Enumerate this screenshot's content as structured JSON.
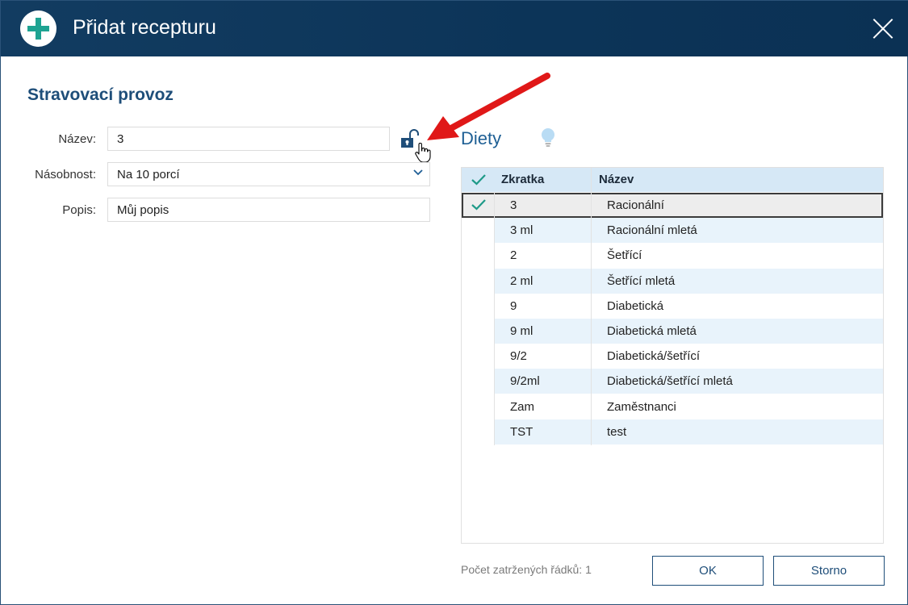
{
  "window": {
    "title": "Přidat recepturu",
    "header_bg": "#0d365a",
    "accent": "#1ea392"
  },
  "form": {
    "section_title": "Stravovací provoz",
    "name_label": "Název:",
    "name_value": "3",
    "multiplicity_label": "Násobnost:",
    "multiplicity_value": "Na 10 porcí",
    "description_label": "Popis:",
    "description_value": "Můj popis",
    "lock_state": "unlocked"
  },
  "diets": {
    "title": "Diety",
    "columns": [
      "Zkratka",
      "Název"
    ],
    "rows": [
      {
        "code": "3",
        "name": "Racionální",
        "checked": true,
        "selected": true
      },
      {
        "code": "3 ml",
        "name": "Racionální mletá",
        "checked": false
      },
      {
        "code": "2",
        "name": "Šetřící",
        "checked": false
      },
      {
        "code": "2 ml",
        "name": "Šetřící mletá",
        "checked": false
      },
      {
        "code": "9",
        "name": "Diabetická",
        "checked": false
      },
      {
        "code": "9 ml",
        "name": "Diabetická mletá",
        "checked": false
      },
      {
        "code": "9/2",
        "name": "Diabetická/šetřící",
        "checked": false
      },
      {
        "code": "9/2ml",
        "name": "Diabetická/šetřící mletá",
        "checked": false
      },
      {
        "code": "Zam",
        "name": "Zaměstnanci",
        "checked": false
      },
      {
        "code": "TST",
        "name": "test",
        "checked": false
      }
    ]
  },
  "footer": {
    "checked_count_text": "Počet zatržených řádků: 1",
    "ok_label": "OK",
    "cancel_label": "Storno"
  }
}
